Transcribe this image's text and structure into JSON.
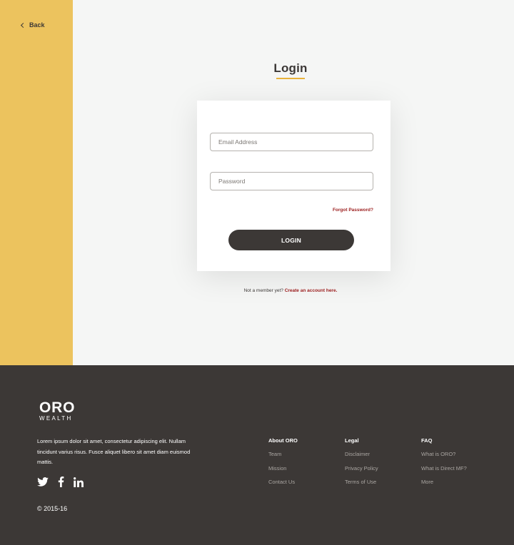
{
  "back": {
    "label": "Back"
  },
  "login": {
    "title": "Login",
    "email_placeholder": "Email Address",
    "password_placeholder": "Password",
    "forgot_label": "Forgot Password?",
    "button_label": "LOGIN",
    "signup_prefix": "Not a member yet?",
    "signup_link": "Create an account here."
  },
  "footer": {
    "logo_main": "ORO",
    "logo_sub": "WEALTH",
    "about_text": "Lorem ipsum dolor sit amet, consectetur adipiscing elit. Nullam tincidunt varius risus. Fusce aliquet libero sit amet diam euismod mattis.",
    "social_icons": [
      "twitter-icon",
      "facebook-icon",
      "linkedin-icon"
    ],
    "copyright": "© 2015-16",
    "columns": [
      {
        "heading": "About ORO",
        "links": [
          "Team",
          "Mission",
          "Contact Us"
        ]
      },
      {
        "heading": "Legal",
        "links": [
          "Disclaimer",
          "Privacy Policy",
          "Terms of Use"
        ]
      },
      {
        "heading": "FAQ",
        "links": [
          "What is ORO?",
          "What is Direct MF?",
          "More"
        ]
      }
    ]
  },
  "colors": {
    "sidebar": "#ecc35e",
    "accent_underline": "#e8b23a",
    "dark": "#3c3836",
    "link_red": "#9b1c1c",
    "background": "#f5f6f5"
  }
}
